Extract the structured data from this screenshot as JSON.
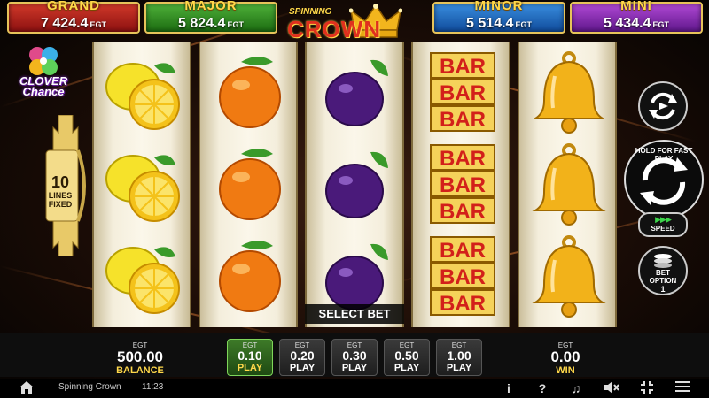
{
  "jackpots": {
    "grand": {
      "name": "GRAND",
      "value": "7 424.4",
      "currency": "EGT"
    },
    "major": {
      "name": "MAJOR",
      "value": "5 824.4",
      "currency": "EGT"
    },
    "minor": {
      "name": "MINOR",
      "value": "5 514.4",
      "currency": "EGT"
    },
    "mini": {
      "name": "MINI",
      "value": "5 434.4",
      "currency": "EGT"
    }
  },
  "logo": {
    "top": "SPINNING",
    "main": "CROWN"
  },
  "clover_chance": {
    "line1": "CLOVER",
    "line2": "Chance"
  },
  "lines": {
    "count": "10",
    "label1": "LINES",
    "label2": "FIXED"
  },
  "reels": [
    [
      "lemon",
      "lemon",
      "lemon"
    ],
    [
      "orange",
      "orange",
      "orange"
    ],
    [
      "plum",
      "plum",
      "plum"
    ],
    [
      "bar",
      "bar",
      "bar"
    ],
    [
      "bell",
      "bell",
      "bell"
    ]
  ],
  "symbols": {
    "bar_text": "BAR"
  },
  "select_bet": "SELECT BET",
  "controls": {
    "hold_text": "HOLD FOR FAST PLAY",
    "speed": {
      "arrows": "▶▶▶",
      "label": "SPEED"
    },
    "bet_option": {
      "label1": "BET",
      "label2": "OPTION",
      "value": "1"
    }
  },
  "balance": {
    "currency": "EGT",
    "value": "500.00",
    "label": "BALANCE"
  },
  "win": {
    "currency": "EGT",
    "value": "0.00",
    "label": "WIN"
  },
  "bets": [
    {
      "currency": "EGT",
      "value": "0.10",
      "label": "PLAY",
      "active": true
    },
    {
      "currency": "EGT",
      "value": "0.20",
      "label": "PLAY",
      "active": false
    },
    {
      "currency": "EGT",
      "value": "0.30",
      "label": "PLAY",
      "active": false
    },
    {
      "currency": "EGT",
      "value": "0.50",
      "label": "PLAY",
      "active": false
    },
    {
      "currency": "EGT",
      "value": "1.00",
      "label": "PLAY",
      "active": false
    }
  ],
  "status_bar": {
    "game_name": "Spinning Crown",
    "time": "11:23",
    "icons": [
      "home-icon",
      "info-icon",
      "help-icon",
      "music-icon",
      "mute-icon",
      "fullscreen-icon",
      "menu-icon"
    ]
  },
  "colors": {
    "grand": "#d23a2a",
    "major": "#4fb23a",
    "minor": "#3a8fe0",
    "mini": "#b24ad6",
    "gold": "#ffd84a",
    "active_bet": "#3d7a28"
  }
}
